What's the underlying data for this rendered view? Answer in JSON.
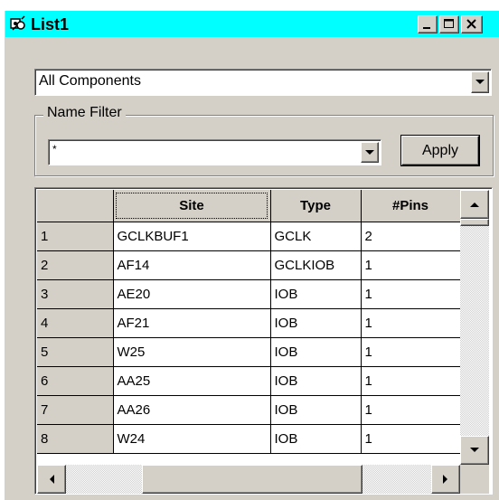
{
  "window": {
    "title": "List1"
  },
  "component_filter": {
    "selected": "All Components"
  },
  "name_filter": {
    "label": "Name Filter",
    "value": "*",
    "apply_label": "Apply"
  },
  "grid": {
    "columns": [
      "",
      "Site",
      "Type",
      "#Pins"
    ],
    "rows": [
      {
        "num": "1",
        "site": "GCLKBUF1",
        "type": "GCLK",
        "pins": "2"
      },
      {
        "num": "2",
        "site": "AF14",
        "type": "GCLKIOB",
        "pins": "1"
      },
      {
        "num": "3",
        "site": "AE20",
        "type": "IOB",
        "pins": "1"
      },
      {
        "num": "4",
        "site": "AF21",
        "type": "IOB",
        "pins": "1"
      },
      {
        "num": "5",
        "site": "W25",
        "type": "IOB",
        "pins": "1"
      },
      {
        "num": "6",
        "site": "AA25",
        "type": "IOB",
        "pins": "1"
      },
      {
        "num": "7",
        "site": "AA26",
        "type": "IOB",
        "pins": "1"
      },
      {
        "num": "8",
        "site": "W24",
        "type": "IOB",
        "pins": "1"
      }
    ]
  },
  "colors": {
    "title_bar": "#00ffff",
    "face": "#d4d0c8"
  },
  "icons": [
    "app-icon",
    "minimize-icon",
    "maximize-icon",
    "close-icon",
    "dropdown-arrow-icon",
    "scroll-up-icon",
    "scroll-down-icon",
    "scroll-left-icon",
    "scroll-right-icon"
  ]
}
